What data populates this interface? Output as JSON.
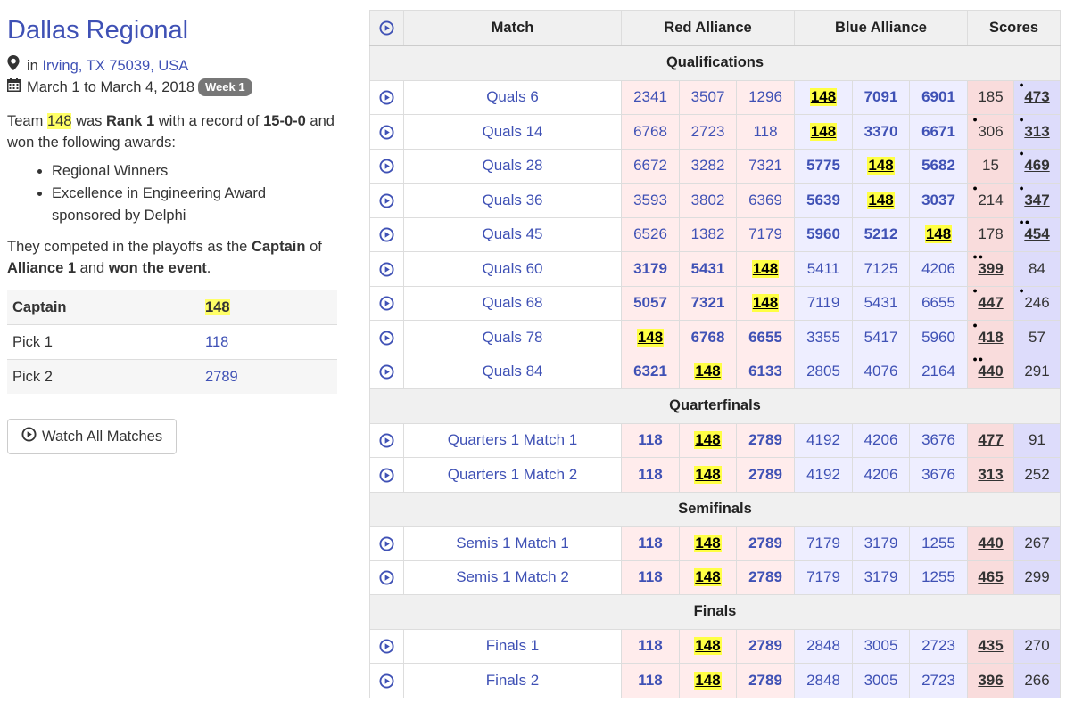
{
  "event": {
    "title": "Dallas Regional",
    "location_prefix": "in",
    "location": "Irving, TX 75039, USA",
    "dates": "March 1 to March 4, 2018",
    "week": "Week 1"
  },
  "summary": {
    "t1": "Team",
    "team": "148",
    "t2": "was",
    "rank": "Rank 1",
    "t3": "with a record of",
    "record": "15-0-0",
    "t4": "and won the following awards:"
  },
  "awards": [
    "Regional Winners",
    "Excellence in Engineering Award sponsored by Delphi"
  ],
  "playoff": {
    "t1": "They competed in the playoffs as the",
    "role": "Captain",
    "t2": "of",
    "alliance": "Alliance 1",
    "t3": "and",
    "result": "won the event",
    "t4": "."
  },
  "alliance_table": [
    {
      "label": "Captain",
      "team": "148",
      "highlight": true,
      "bold": true
    },
    {
      "label": "Pick 1",
      "team": "118",
      "highlight": false,
      "bold": false
    },
    {
      "label": "Pick 2",
      "team": "2789",
      "highlight": false,
      "bold": false
    }
  ],
  "watch_button": "Watch All Matches",
  "table_headers": {
    "match": "Match",
    "red": "Red Alliance",
    "blue": "Blue Alliance",
    "scores": "Scores"
  },
  "colors": {
    "accent": "#3f51b5",
    "highlight": "#ffff44",
    "red_bg": "#ffecec",
    "blue_bg": "#eeeeff"
  },
  "sections": [
    {
      "name": "Qualifications",
      "matches": [
        {
          "name": "Quals 6",
          "red": [
            "2341",
            "3507",
            "1296"
          ],
          "blue": [
            "148",
            "7091",
            "6901"
          ],
          "red_score": "185",
          "blue_score": "473",
          "winner": "blue",
          "red_dots": 0,
          "blue_dots": 1
        },
        {
          "name": "Quals 14",
          "red": [
            "6768",
            "2723",
            "118"
          ],
          "blue": [
            "148",
            "3370",
            "6671"
          ],
          "red_score": "306",
          "blue_score": "313",
          "winner": "blue",
          "red_dots": 1,
          "blue_dots": 1
        },
        {
          "name": "Quals 28",
          "red": [
            "6672",
            "3282",
            "7321"
          ],
          "blue": [
            "5775",
            "148",
            "5682"
          ],
          "red_score": "15",
          "blue_score": "469",
          "winner": "blue",
          "red_dots": 0,
          "blue_dots": 1
        },
        {
          "name": "Quals 36",
          "red": [
            "3593",
            "3802",
            "6369"
          ],
          "blue": [
            "5639",
            "148",
            "3037"
          ],
          "red_score": "214",
          "blue_score": "347",
          "winner": "blue",
          "red_dots": 1,
          "blue_dots": 1
        },
        {
          "name": "Quals 45",
          "red": [
            "6526",
            "1382",
            "7179"
          ],
          "blue": [
            "5960",
            "5212",
            "148"
          ],
          "red_score": "178",
          "blue_score": "454",
          "winner": "blue",
          "red_dots": 0,
          "blue_dots": 2
        },
        {
          "name": "Quals 60",
          "red": [
            "3179",
            "5431",
            "148"
          ],
          "blue": [
            "5411",
            "7125",
            "4206"
          ],
          "red_score": "399",
          "blue_score": "84",
          "winner": "red",
          "red_dots": 2,
          "blue_dots": 0
        },
        {
          "name": "Quals 68",
          "red": [
            "5057",
            "7321",
            "148"
          ],
          "blue": [
            "7119",
            "5431",
            "6655"
          ],
          "red_score": "447",
          "blue_score": "246",
          "winner": "red",
          "red_dots": 1,
          "blue_dots": 1
        },
        {
          "name": "Quals 78",
          "red": [
            "148",
            "6768",
            "6655"
          ],
          "blue": [
            "3355",
            "5417",
            "5960"
          ],
          "red_score": "418",
          "blue_score": "57",
          "winner": "red",
          "red_dots": 1,
          "blue_dots": 0
        },
        {
          "name": "Quals 84",
          "red": [
            "6321",
            "148",
            "6133"
          ],
          "blue": [
            "2805",
            "4076",
            "2164"
          ],
          "red_score": "440",
          "blue_score": "291",
          "winner": "red",
          "red_dots": 2,
          "blue_dots": 0
        }
      ]
    },
    {
      "name": "Quarterfinals",
      "matches": [
        {
          "name": "Quarters 1 Match 1",
          "red": [
            "118",
            "148",
            "2789"
          ],
          "blue": [
            "4192",
            "4206",
            "3676"
          ],
          "red_score": "477",
          "blue_score": "91",
          "winner": "red",
          "red_dots": 0,
          "blue_dots": 0
        },
        {
          "name": "Quarters 1 Match 2",
          "red": [
            "118",
            "148",
            "2789"
          ],
          "blue": [
            "4192",
            "4206",
            "3676"
          ],
          "red_score": "313",
          "blue_score": "252",
          "winner": "red",
          "red_dots": 0,
          "blue_dots": 0
        }
      ]
    },
    {
      "name": "Semifinals",
      "matches": [
        {
          "name": "Semis 1 Match 1",
          "red": [
            "118",
            "148",
            "2789"
          ],
          "blue": [
            "7179",
            "3179",
            "1255"
          ],
          "red_score": "440",
          "blue_score": "267",
          "winner": "red",
          "red_dots": 0,
          "blue_dots": 0
        },
        {
          "name": "Semis 1 Match 2",
          "red": [
            "118",
            "148",
            "2789"
          ],
          "blue": [
            "7179",
            "3179",
            "1255"
          ],
          "red_score": "465",
          "blue_score": "299",
          "winner": "red",
          "red_dots": 0,
          "blue_dots": 0
        }
      ]
    },
    {
      "name": "Finals",
      "matches": [
        {
          "name": "Finals 1",
          "red": [
            "118",
            "148",
            "2789"
          ],
          "blue": [
            "2848",
            "3005",
            "2723"
          ],
          "red_score": "435",
          "blue_score": "270",
          "winner": "red",
          "red_dots": 0,
          "blue_dots": 0
        },
        {
          "name": "Finals 2",
          "red": [
            "118",
            "148",
            "2789"
          ],
          "blue": [
            "2848",
            "3005",
            "2723"
          ],
          "red_score": "396",
          "blue_score": "266",
          "winner": "red",
          "red_dots": 0,
          "blue_dots": 0
        }
      ]
    }
  ],
  "focus_team": "148",
  "icons": {
    "location": "map-marker-icon",
    "calendar": "calendar-icon",
    "play": "play-circle-icon"
  }
}
